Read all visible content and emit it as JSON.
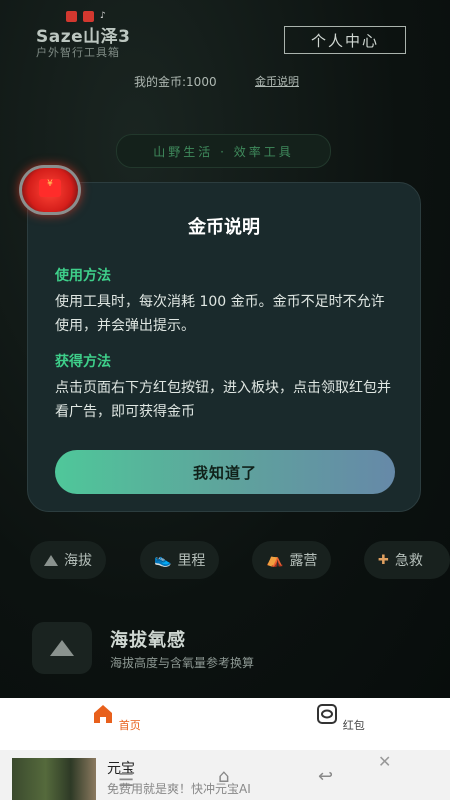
{
  "header": {
    "brand": "Saze山泽3",
    "subtitle": "户外智行工具箱",
    "profile_button": "个人中心",
    "coins": "我的金币:1000",
    "coin_help_link": "金币说明",
    "slogan": "山野生活 · 效率工具"
  },
  "modal": {
    "title": "金币说明",
    "section1_title": "使用方法",
    "section1_body": "使用工具时，每次消耗 100 金币。金币不足时不允许使用，并会弹出提示。",
    "section2_title": "获得方法",
    "section2_body": "点击页面右下方红包按钮，进入板块，点击领取红包并看广告，即可获得金币",
    "ok_button": "我知道了"
  },
  "chips": [
    {
      "label": "海拔",
      "icon": "mountain-icon"
    },
    {
      "label": "里程",
      "icon": "shoe-icon"
    },
    {
      "label": "露营",
      "icon": "tent-icon"
    },
    {
      "label": "急救",
      "icon": "bandage-icon"
    }
  ],
  "feature": {
    "title": "海拔氧感",
    "subtitle": "海拔高度与含氧量参考换算"
  },
  "tabbar": {
    "home": "首页",
    "redpack": "红包"
  },
  "ad": {
    "title": "元宝",
    "subtitle": "免费用就是爽！快冲元宝AI"
  },
  "colors": {
    "accent_green": "#3ecf8a",
    "tab_active": "#e8601c",
    "redpack": "#d41e1a"
  }
}
